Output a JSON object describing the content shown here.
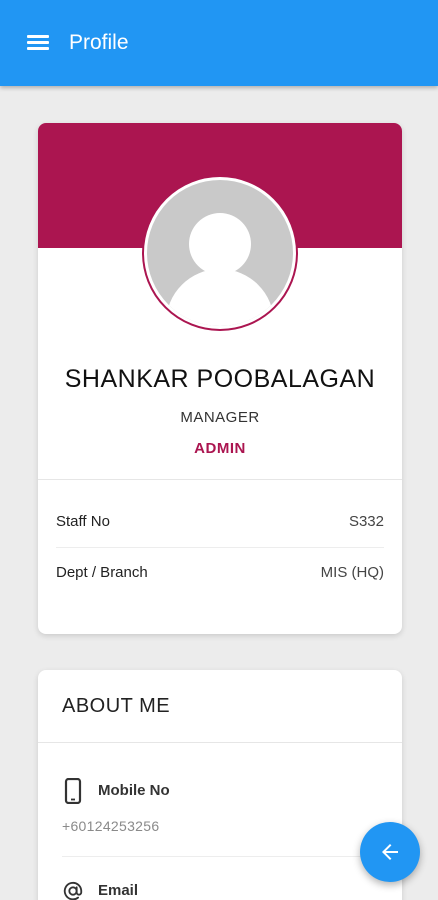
{
  "appbar": {
    "title": "Profile",
    "menu_icon": "hamburger-menu-icon",
    "color": "#2196f3"
  },
  "profile": {
    "name": "SHANKAR POOBALAGAN",
    "role": "MANAGER",
    "access_level": "ADMIN",
    "avatar_icon": "user-placeholder-icon",
    "accent_color": "#ab1550",
    "details": [
      {
        "label": "Staff No",
        "value": "S332"
      },
      {
        "label": "Dept / Branch",
        "value": "MIS (HQ)"
      }
    ]
  },
  "about": {
    "title": "ABOUT ME",
    "items": [
      {
        "icon": "mobile-phone-icon",
        "label": "Mobile No",
        "value": "+60124253256"
      },
      {
        "icon": "at-sign-icon",
        "label": "Email",
        "value": ""
      }
    ]
  },
  "fab": {
    "icon": "arrow-left-icon"
  }
}
